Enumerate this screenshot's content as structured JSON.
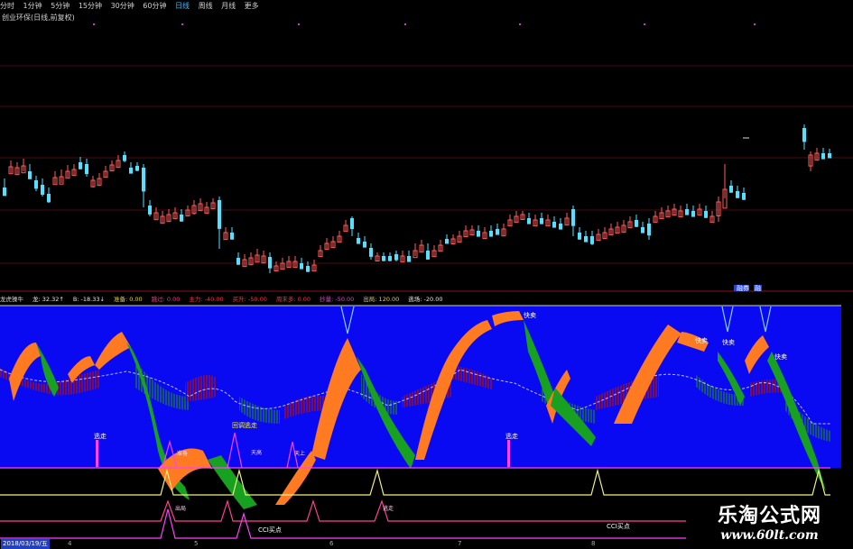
{
  "toolbar": {
    "tabs": [
      {
        "label": "分时"
      },
      {
        "label": "1分钟"
      },
      {
        "label": "5分钟"
      },
      {
        "label": "15分钟"
      },
      {
        "label": "30分钟"
      },
      {
        "label": "60分钟"
      },
      {
        "label": "日线",
        "active": true
      },
      {
        "label": "周线"
      },
      {
        "label": "月线"
      },
      {
        "label": "更多"
      }
    ]
  },
  "stock_title": "创业环保(日线,前复权)",
  "markers": {
    "upper_right": [
      "财",
      "融券",
      "融"
    ]
  },
  "indicator_header": {
    "items": [
      {
        "text": "龙虎操牛",
        "color": "#d8d8d8"
      },
      {
        "text": "龙: 32.32↑",
        "color": "#e8e8e8"
      },
      {
        "text": "B: -18.33↓",
        "color": "#e8e8e8"
      },
      {
        "text": "准备: 0.00",
        "color": "#e0d050"
      },
      {
        "text": "跳过: 0.00",
        "color": "#e0408a"
      },
      {
        "text": "主力: -40.00",
        "color": "#e04040"
      },
      {
        "text": "买升: -50.00",
        "color": "#e04040"
      },
      {
        "text": "周末多: 0.00",
        "color": "#e04040"
      },
      {
        "text": "抄量: -50.00",
        "color": "#e040d0"
      },
      {
        "text": "出局: 120.00",
        "color": "#e0d050"
      },
      {
        "text": "逃场: -20.00",
        "color": "#e8e8e8"
      }
    ]
  },
  "annotations": {
    "sell_signal": "快卖",
    "escape": "逃走",
    "cci_buy": "CCI买点",
    "mid_signal": "回调逃走",
    "small_labels": [
      "准备",
      "天高",
      "天上",
      "出局",
      "逃走"
    ]
  },
  "date_bar": {
    "current_date": "2018/03/19/五",
    "months": [
      "4",
      "5",
      "6",
      "7",
      "8"
    ]
  },
  "watermark": {
    "main": "乐淘公式网",
    "url": "www.60lt.com"
  },
  "colors": {
    "up_candle": "#ff5a5a",
    "down_candle": "#55e0ff",
    "indicator_bg": "#0a0af2",
    "ribbon_orange": "#ff7a20",
    "ribbon_green": "#18a020",
    "hatch_red": "#b01010",
    "hatch_green": "#208040",
    "magenta": "#ff40ff",
    "yellow": "#f0f080",
    "pink": "#ff4090",
    "grid": "#6a0a1a"
  }
}
